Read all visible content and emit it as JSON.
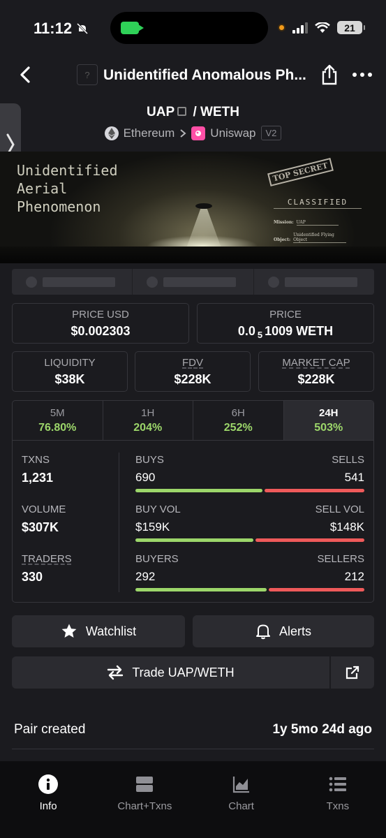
{
  "status_bar": {
    "time": "11:12",
    "battery": "21"
  },
  "header": {
    "title": "Unidentified Anomalous Ph...",
    "logo_placeholder": "?"
  },
  "pair": {
    "base": "UAP",
    "separator": "/",
    "quote": "WETH",
    "chain": "Ethereum",
    "dex": "Uniswap",
    "version": "V2"
  },
  "banner": {
    "title": "Unidentified\nAerial\nPhenomenon",
    "stamp": "TOP SECRET",
    "classified": "CLASSIFIED",
    "mission_label": "Mission:",
    "mission_value": "UAP",
    "object_label": "Object:",
    "object_value": "Unidentified Flying Object"
  },
  "prices": {
    "price_usd_label": "PRICE USD",
    "price_usd": "$0.002303",
    "price_label": "PRICE",
    "price_prefix": "0.0",
    "price_sub": "5",
    "price_suffix": "1009 WETH"
  },
  "metrics": [
    {
      "label": "LIQUIDITY",
      "value": "$38K"
    },
    {
      "label": "FDV",
      "value": "$228K"
    },
    {
      "label": "MARKET CAP",
      "value": "$228K"
    }
  ],
  "periods": [
    {
      "label": "5M",
      "value": "76.80%"
    },
    {
      "label": "1H",
      "value": "204%"
    },
    {
      "label": "6H",
      "value": "252%"
    },
    {
      "label": "24H",
      "value": "503%"
    }
  ],
  "active_period": "24H",
  "stats": {
    "txns_label": "TXNS",
    "txns": "1,231",
    "buys_label": "BUYS",
    "buys": "690",
    "sells_label": "SELLS",
    "sells": "541",
    "volume_label": "VOLUME",
    "volume": "$307K",
    "buy_vol_label": "BUY VOL",
    "buy_vol": "$159K",
    "sell_vol_label": "SELL VOL",
    "sell_vol": "$148K",
    "traders_label": "TRADERS",
    "traders": "330",
    "buyers_label": "BUYERS",
    "buyers": "292",
    "sellers_label": "SELLERS",
    "sellers": "212"
  },
  "bar_ratios": {
    "buys": 0.56,
    "buy_vol": 0.52,
    "buyers": 0.58
  },
  "buttons": {
    "watchlist": "Watchlist",
    "alerts": "Alerts",
    "trade": "Trade UAP/WETH"
  },
  "pair_created": {
    "label": "Pair created",
    "value": "1y 5mo 24d ago"
  },
  "nav": [
    {
      "label": "Info",
      "icon": "info-icon"
    },
    {
      "label": "Chart+Txns",
      "icon": "chart-txns-icon"
    },
    {
      "label": "Chart",
      "icon": "chart-icon"
    },
    {
      "label": "Txns",
      "icon": "list-icon"
    }
  ],
  "colors": {
    "buy": "#9cd66a",
    "sell": "#ef5a5a",
    "background": "#1b1b1f"
  }
}
